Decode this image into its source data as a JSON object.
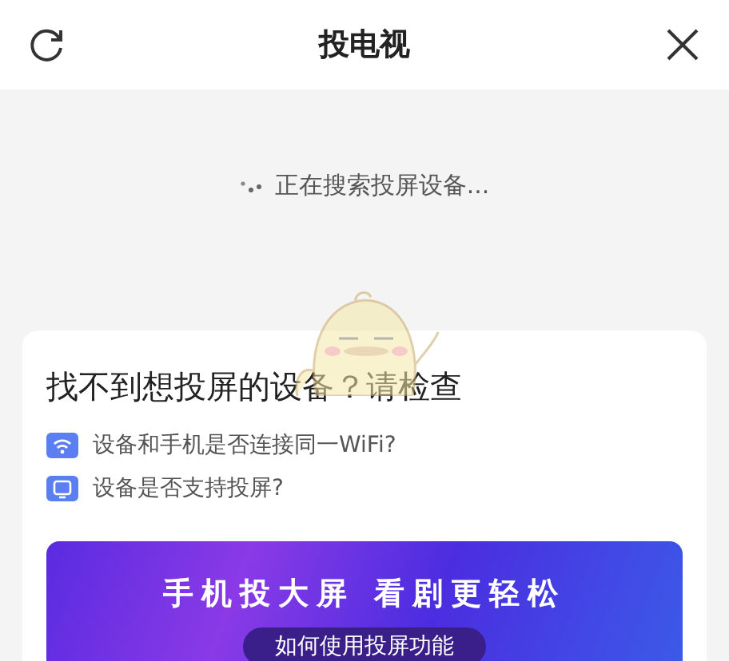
{
  "header": {
    "title": "投电视"
  },
  "search_status": {
    "text": "正在搜索投屏设备..."
  },
  "help_card": {
    "title": "找不到想投屏的设备？请检查",
    "items": [
      {
        "kind": "wifi",
        "text": "设备和手机是否连接同一WiFi?"
      },
      {
        "kind": "tv",
        "text": "设备是否支持投屏?"
      }
    ]
  },
  "banner": {
    "headline": "手机投大屏 看剧更轻松",
    "button": "如何使用投屏功能"
  }
}
